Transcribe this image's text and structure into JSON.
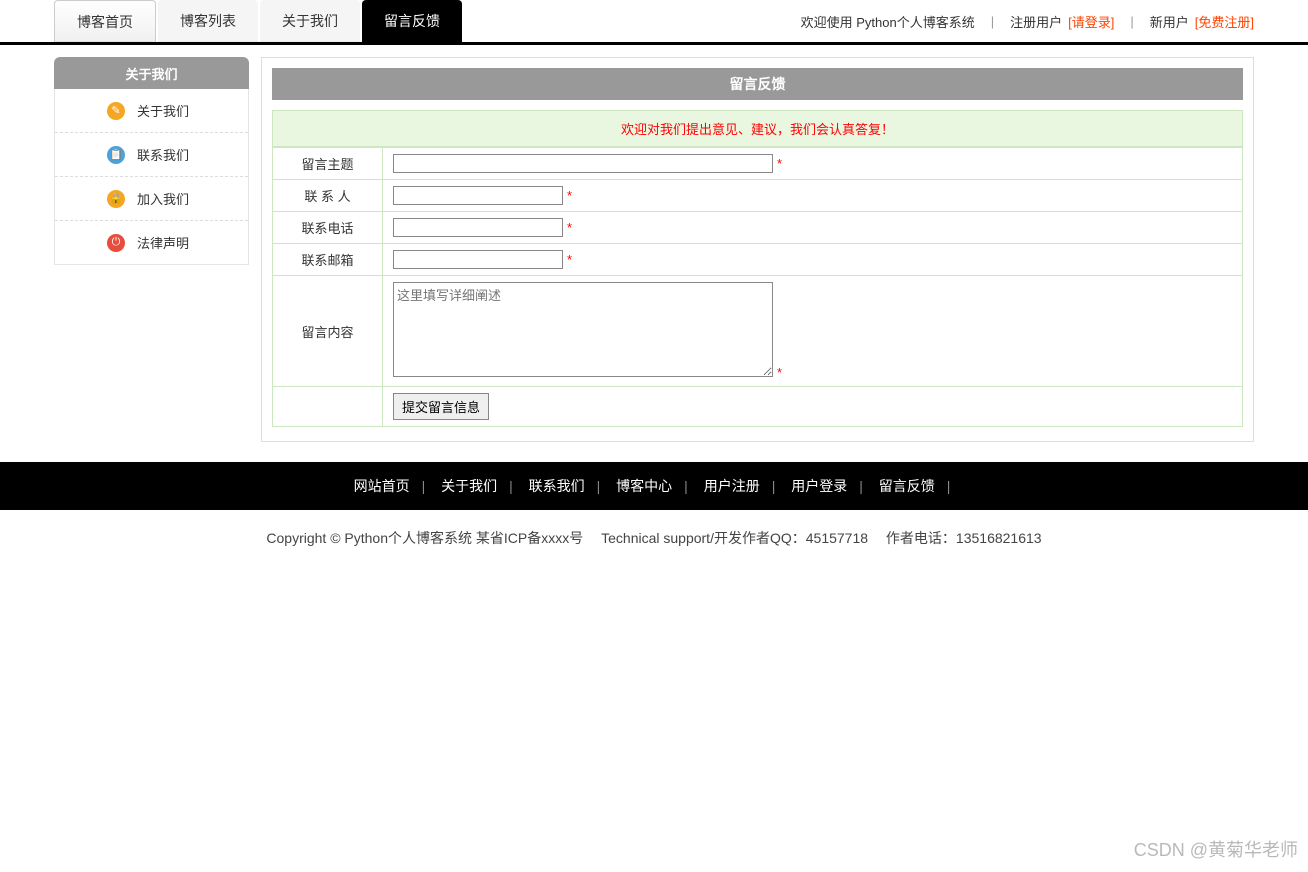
{
  "nav": {
    "tabs": [
      {
        "label": "博客首页"
      },
      {
        "label": "博客列表"
      },
      {
        "label": "关于我们"
      },
      {
        "label": "留言反馈"
      }
    ],
    "welcome": "欢迎使用 Python个人博客系统",
    "login_prefix": "注册用户 ",
    "login_link": "[请登录]",
    "register_prefix": "新用户 ",
    "register_link": "[免费注册]"
  },
  "sidebar": {
    "title": "关于我们",
    "items": [
      {
        "label": "关于我们",
        "icon": "✎",
        "color": "#f5a623"
      },
      {
        "label": "联系我们",
        "icon": "📋",
        "color": "#4aa3df"
      },
      {
        "label": "加入我们",
        "icon": "🔒",
        "color": "#f5a623"
      },
      {
        "label": "法律声明",
        "icon": "⏻",
        "color": "#e74c3c"
      }
    ]
  },
  "panel": {
    "title": "留言反馈",
    "notice": "欢迎对我们提出意见、建议，我们会认真答复！"
  },
  "form": {
    "subject_label": "留言主题",
    "contact_label": "联 系 人",
    "phone_label": "联系电话",
    "email_label": "联系邮箱",
    "content_label": "留言内容",
    "content_placeholder": "这里填写详细阐述",
    "submit_label": "提交留言信息",
    "required": "*"
  },
  "footer": {
    "links": [
      "网站首页",
      "关于我们",
      "联系我们",
      "博客中心",
      "用户注册",
      "用户登录",
      "留言反馈"
    ],
    "copyright": "Copyright © Python个人博客系统 某省ICP备xxxx号　 Technical support/开发作者QQ：45157718　 作者电话：13516821613"
  },
  "watermark": "CSDN @黄菊华老师"
}
